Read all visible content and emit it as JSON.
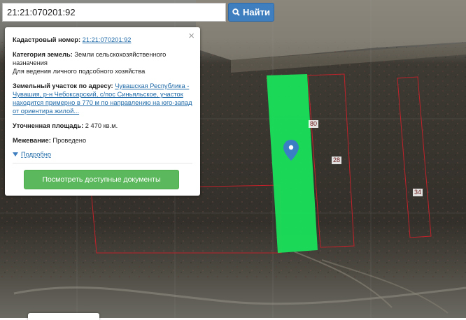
{
  "search": {
    "value": "21:21:070201:92",
    "button_label": "Найти",
    "button_icon": "search-icon"
  },
  "popup": {
    "cadastral_label": "Кадастровый номер:",
    "cadastral_value": "21:21:070201:92",
    "category_label": "Категория земель:",
    "category_value": "Земли сельскохозяйственного назначения",
    "use_value": "Для ведения личного подсобного хозяйства",
    "address_label": "Земельный участок по адресу:",
    "address_value": "Чувашская Республика - Чувашия, р-н Чебоксарский, с/пос Синьяльское, участок находится примерно в 770 м по направлению на юго-запад от ориентира жилой...",
    "area_label": "Уточненная площадь:",
    "area_value": "2 470 кв.м.",
    "survey_label": "Межевание:",
    "survey_value": "Проведено",
    "more_label": "Подробно",
    "docs_button": "Посмотреть доступные документы",
    "close_symbol": "×"
  },
  "map": {
    "parcel_labels": [
      "80",
      "28",
      "34"
    ],
    "highlight_color": "#19e05a",
    "boundary_color": "#c0222a",
    "marker_color": "#3a7fc4",
    "marker_icon": "map-pin-icon"
  }
}
